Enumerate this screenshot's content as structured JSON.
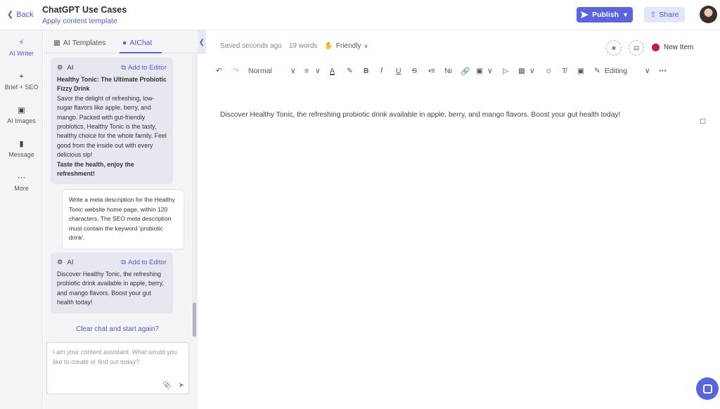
{
  "topbar": {
    "back_label": "Back",
    "title": "ChatGPT Use Cases",
    "subtitle": "Apply content template",
    "publish_label": "Publish",
    "share_label": "Share"
  },
  "leftnav": {
    "items": [
      {
        "label": "AI Writer",
        "icon": "bolt-icon"
      },
      {
        "label": "Brief + SEO",
        "icon": "target-icon"
      },
      {
        "label": "AI Images",
        "icon": "image-icon"
      },
      {
        "label": "Message",
        "icon": "message-icon"
      },
      {
        "label": "More",
        "icon": "more-icon"
      }
    ]
  },
  "panel": {
    "tabs": [
      {
        "label": "AI Templates",
        "icon": "templates-icon"
      },
      {
        "label": "AIChat",
        "icon": "chat-icon"
      }
    ],
    "messages": [
      {
        "role": "AI",
        "add_label": "Add to Editor",
        "heading": "Healthy Tonic: The Ultimate Probiotic Fizzy Drink",
        "body": "Savor the delight of refreshing, low-sugar flavors like apple, berry, and mango. Packed with gut-friendly probiotics, Healthy Tonic is the tasty, healthy choice for the whole family. Feel good from the inside out with every delicious sip!",
        "footer": "Taste the health, enjoy the refreshment!"
      },
      {
        "role": "User",
        "body": "Write a meta description for the Healthy Tonic website home page, within 120 characters. The SEO meta description must contain the keyword 'probiotic drink'."
      },
      {
        "role": "AI",
        "add_label": "Add to Editor",
        "body": "Discover Healthy Tonic, the refreshing probiotic drink available in apple, berry, and mango flavors. Boost your gut health today!"
      }
    ],
    "clear_label": "Clear chat and start again?",
    "input_placeholder": "I am your content assistant. What would you like to create or find out today?"
  },
  "editor": {
    "saved": "Saved seconds ago",
    "words": "19 words",
    "tone": "Friendly",
    "new_item": "New Item",
    "block_style": "Normal",
    "mode": "Editing",
    "content": "Discover Healthy Tonic, the refreshing probiotic drink available in apple, berry, and mango flavors. Boost your gut health today!"
  },
  "colors": {
    "accent": "#5a63e0",
    "status_dot": "#d0133a"
  }
}
